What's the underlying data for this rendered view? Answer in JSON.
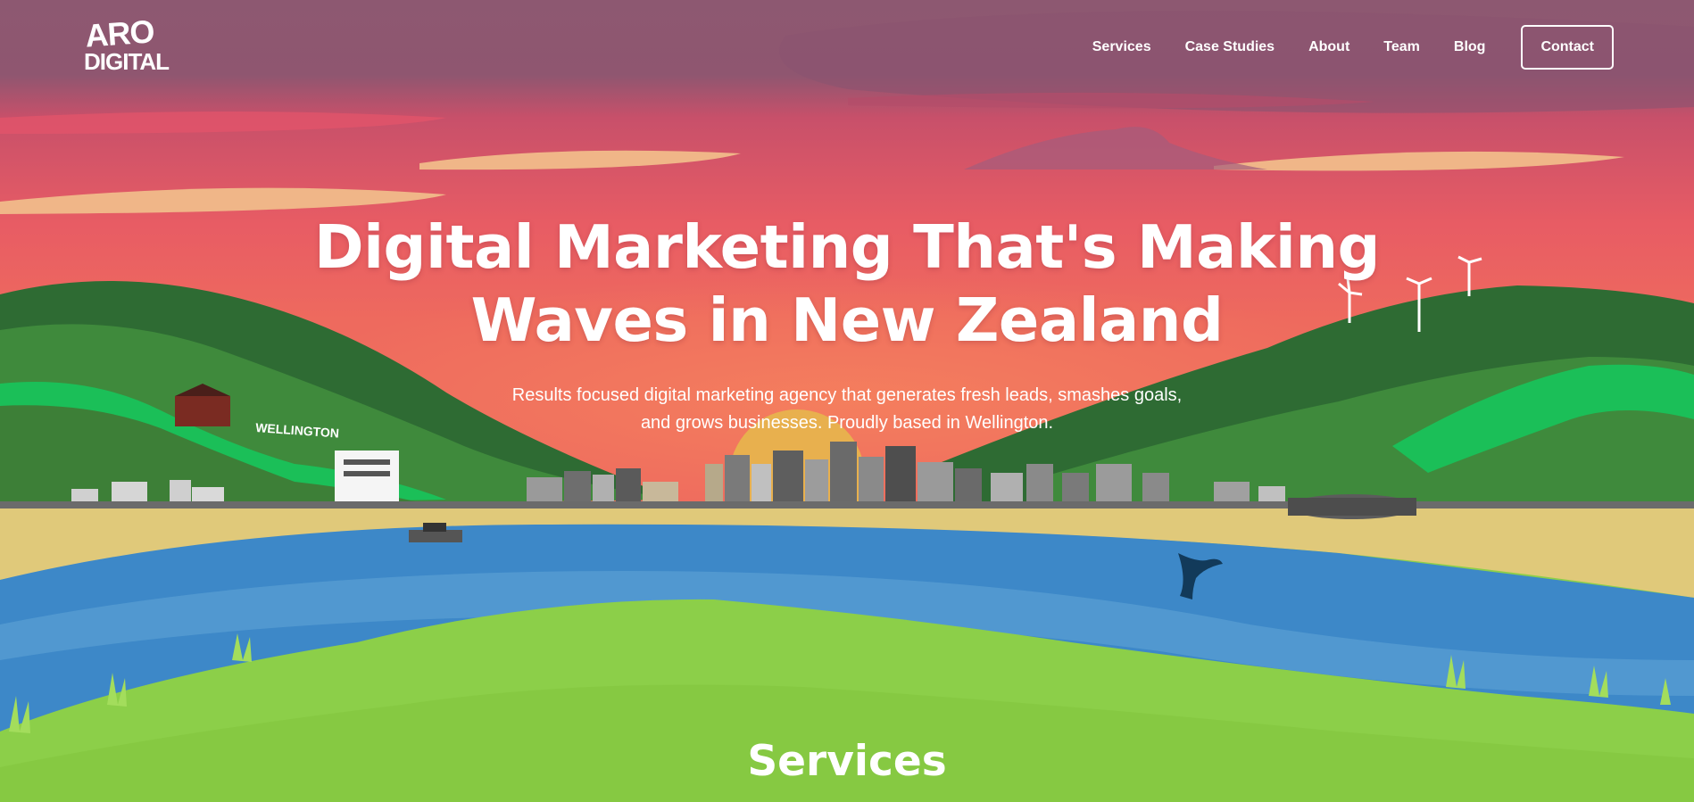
{
  "brand": {
    "logo_top": "ARO",
    "logo_bottom": "DIGITAL",
    "sign_text": "WELLINGTON"
  },
  "nav": {
    "items": [
      {
        "label": "Services"
      },
      {
        "label": "Case Studies"
      },
      {
        "label": "About"
      },
      {
        "label": "Team"
      },
      {
        "label": "Blog"
      }
    ],
    "contact_label": "Contact"
  },
  "hero": {
    "title_line1": "Digital Marketing That's Making",
    "title_line2": "Waves in New Zealand",
    "subtitle_line1": "Results focused digital marketing agency that generates fresh leads, smashes goals,",
    "subtitle_line2": "and grows businesses. Proudly based in Wellington."
  },
  "services": {
    "heading": "Services"
  },
  "colors": {
    "sky_top": "#8d5871",
    "sky_mid": "#e2596a",
    "sun": "#e8b04e",
    "hills_dark": "#2e6b33",
    "hills_mid": "#3f8a3c",
    "hills_bright": "#1bbf58",
    "water": "#3d88c8",
    "sand": "#e0c97a",
    "grass": "#8ccf49"
  }
}
